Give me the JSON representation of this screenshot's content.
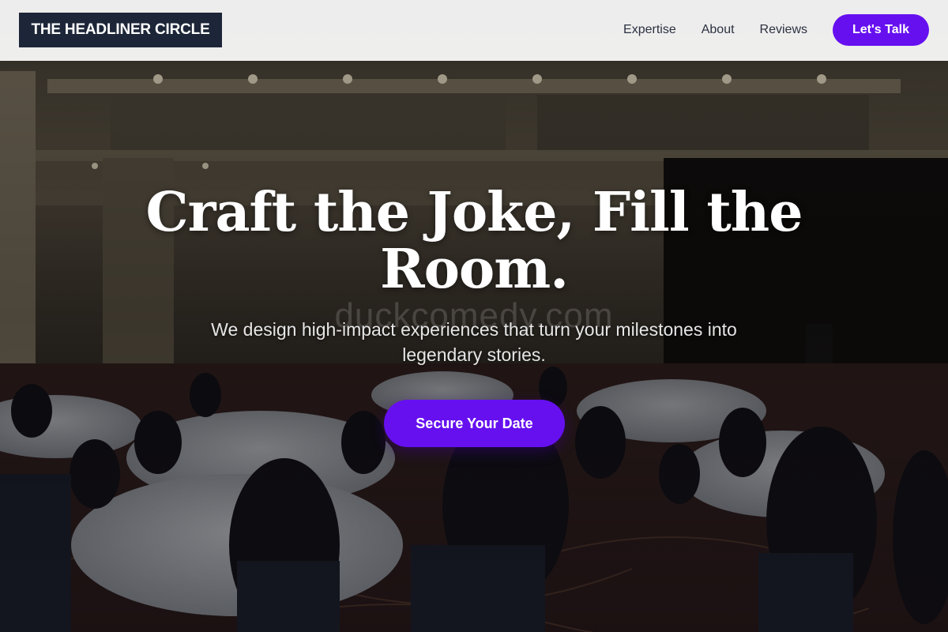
{
  "header": {
    "brand": "THE HEADLINER CIRCLE",
    "nav": [
      {
        "label": "Expertise"
      },
      {
        "label": "About"
      },
      {
        "label": "Reviews"
      }
    ],
    "cta_label": "Let's Talk"
  },
  "hero": {
    "title": "Craft the Joke, Fill the Room.",
    "subtitle": "We design high-impact experiences that turn your milestones into legendary stories.",
    "cta_label": "Secure Your Date",
    "watermark": "duckcomedy.com",
    "background_image": "banquet-hall-event-photo"
  },
  "colors": {
    "accent": "#6610f0",
    "brand_bg": "#1d2638",
    "header_bg": "#f6f6f6",
    "nav_text": "#2a3140",
    "hero_text": "#ffffff"
  }
}
